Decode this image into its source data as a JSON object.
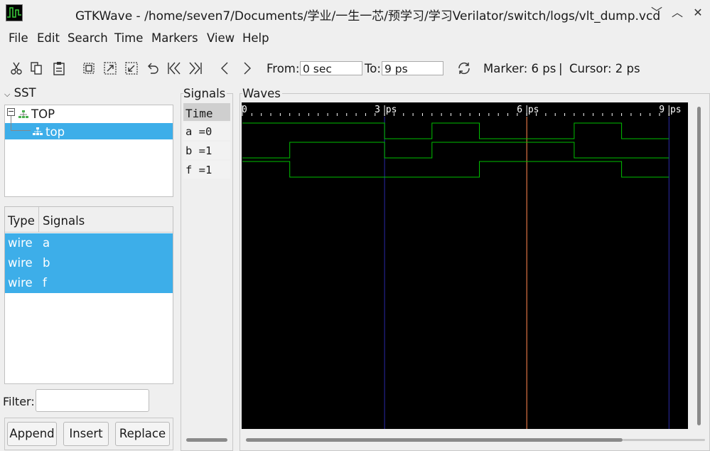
{
  "window": {
    "title": "GTKWave - /home/seven7/Documents/学业/一生一芯/预学习/学习Verilator/switch/logs/vlt_dump.vcd",
    "controls": [
      "﹀",
      "︿",
      "✕"
    ]
  },
  "menu": [
    "File",
    "Edit",
    "Search",
    "Time",
    "Markers",
    "View",
    "Help"
  ],
  "toolbar": {
    "from_label": "From:",
    "from_value": "0 sec",
    "to_label": "To:",
    "to_value": "9 ps",
    "marker_text": "Marker: 6 ps",
    "separator": "|",
    "cursor_text": "Cursor: 2 ps",
    "icons": [
      "cut-icon",
      "copy-icon",
      "paste-icon",
      "zoom-fit-icon",
      "zoom-in-icon",
      "zoom-out-icon",
      "undo-zoom-icon",
      "zoom-to-start-icon",
      "zoom-to-end-icon",
      "prev-edge-icon",
      "next-edge-icon",
      "reload-icon"
    ]
  },
  "sst": {
    "label": "SST",
    "tree": [
      {
        "name": "TOP",
        "expanded": true
      },
      {
        "name": "top",
        "selected": true
      }
    ],
    "columns": [
      "Type",
      "Signals"
    ],
    "signals": [
      {
        "type": "wire",
        "name": "a"
      },
      {
        "type": "wire",
        "name": "b"
      },
      {
        "type": "wire",
        "name": "f"
      }
    ],
    "filter_label": "Filter:",
    "buttons": [
      "Append",
      "Insert",
      "Replace"
    ]
  },
  "signals_panel": {
    "title": "Signals",
    "time_header": "Time",
    "rows": [
      "a =0",
      "b =1",
      "f =1"
    ]
  },
  "waves": {
    "title": "Waves",
    "time_range": [
      0,
      9
    ],
    "time_unit": "ps",
    "tick_labels": [
      "0",
      "3 ps",
      "6 ps",
      "9 ps"
    ],
    "tick_values": [
      0,
      3,
      6,
      9
    ],
    "marker_time": 6,
    "colors": {
      "wave": "#00c000",
      "grid": "#2a2aa8",
      "marker": "#ff7f2a",
      "ruler": "#ffffff"
    },
    "signals": [
      {
        "name": "a",
        "transitions": [
          [
            0,
            1
          ],
          [
            3,
            0
          ],
          [
            4,
            1
          ],
          [
            5,
            0
          ],
          [
            7,
            1
          ],
          [
            8,
            0
          ]
        ]
      },
      {
        "name": "b",
        "transitions": [
          [
            0,
            0
          ],
          [
            1,
            1
          ],
          [
            3,
            0
          ],
          [
            4,
            1
          ],
          [
            7,
            0
          ]
        ]
      },
      {
        "name": "f",
        "transitions": [
          [
            0,
            1
          ],
          [
            1,
            0
          ],
          [
            5,
            1
          ],
          [
            8,
            0
          ]
        ]
      }
    ]
  }
}
